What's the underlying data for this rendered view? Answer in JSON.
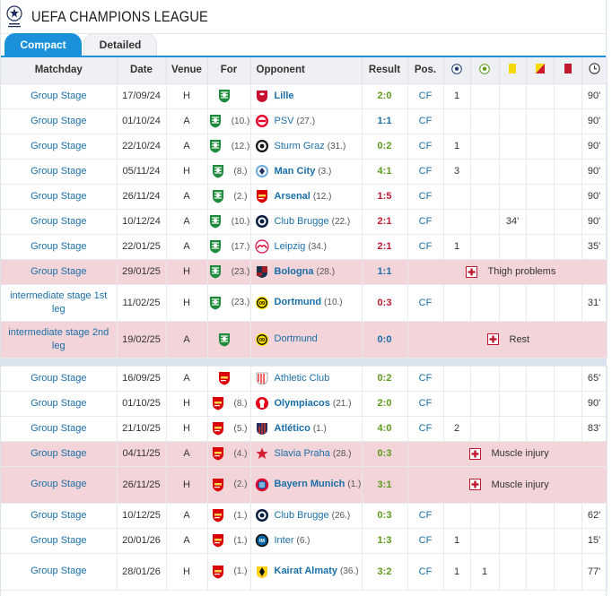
{
  "header": {
    "title": "UEFA CHAMPIONS LEAGUE"
  },
  "tabs": [
    {
      "label": "Compact",
      "active": true
    },
    {
      "label": "Detailed",
      "active": false
    }
  ],
  "columns": {
    "matchday": "Matchday",
    "date": "Date",
    "venue": "Venue",
    "for": "For",
    "opponent": "Opponent",
    "result": "Result",
    "pos": "Pos."
  },
  "colors": {
    "accent": "#1a91da",
    "win": "#5b9a1b",
    "draw": "#1a6fa8",
    "loss": "#c0182d",
    "injury_row": "#f2d4d9"
  },
  "rows": [
    {
      "matchday": "Group Stage",
      "date": "17/09/24",
      "venue": "H",
      "for_club": "sporting",
      "for_rank": "",
      "opponent": "Lille",
      "opp_crest": "lille",
      "opp_rank": "",
      "opp_bold": true,
      "result": "2:0",
      "res": "w",
      "pos": "CF",
      "goals": "1",
      "assists": "",
      "yellow": "",
      "second_yellow": "",
      "red": "",
      "minutes": "90'"
    },
    {
      "matchday": "Group Stage",
      "date": "01/10/24",
      "venue": "A",
      "for_club": "sporting",
      "for_rank": "(10.)",
      "opponent": "PSV",
      "opp_crest": "psv",
      "opp_rank": "(27.)",
      "opp_bold": false,
      "result": "1:1",
      "res": "d",
      "pos": "CF",
      "goals": "",
      "assists": "",
      "yellow": "",
      "second_yellow": "",
      "red": "",
      "minutes": "90'"
    },
    {
      "matchday": "Group Stage",
      "date": "22/10/24",
      "venue": "A",
      "for_club": "sporting",
      "for_rank": "(12.)",
      "opponent": "Sturm Graz",
      "opp_crest": "sturm",
      "opp_rank": "(31.)",
      "opp_bold": false,
      "result": "0:2",
      "res": "w",
      "pos": "CF",
      "goals": "1",
      "assists": "",
      "yellow": "",
      "second_yellow": "",
      "red": "",
      "minutes": "90'"
    },
    {
      "matchday": "Group Stage",
      "date": "05/11/24",
      "venue": "H",
      "for_club": "sporting",
      "for_rank": "(8.)",
      "opponent": "Man City",
      "opp_crest": "mancity",
      "opp_rank": "(3.)",
      "opp_bold": true,
      "result": "4:1",
      "res": "w",
      "pos": "CF",
      "goals": "3",
      "assists": "",
      "yellow": "",
      "second_yellow": "",
      "red": "",
      "minutes": "90'"
    },
    {
      "matchday": "Group Stage",
      "date": "26/11/24",
      "venue": "A",
      "for_club": "sporting",
      "for_rank": "(2.)",
      "opponent": "Arsenal",
      "opp_crest": "arsenal",
      "opp_rank": "(12.)",
      "opp_bold": true,
      "result": "1:5",
      "res": "l",
      "pos": "CF",
      "goals": "",
      "assists": "",
      "yellow": "",
      "second_yellow": "",
      "red": "",
      "minutes": "90'"
    },
    {
      "matchday": "Group Stage",
      "date": "10/12/24",
      "venue": "A",
      "for_club": "sporting",
      "for_rank": "(10.)",
      "opponent": "Club Brugge",
      "opp_crest": "brugge",
      "opp_rank": "(22.)",
      "opp_bold": false,
      "result": "2:1",
      "res": "l",
      "pos": "CF",
      "goals": "",
      "assists": "",
      "yellow": "34'",
      "second_yellow": "",
      "red": "",
      "minutes": "90'"
    },
    {
      "matchday": "Group Stage",
      "date": "22/01/25",
      "venue": "A",
      "for_club": "sporting",
      "for_rank": "(17.)",
      "opponent": "Leipzig",
      "opp_crest": "leipzig",
      "opp_rank": "(34.)",
      "opp_bold": false,
      "result": "2:1",
      "res": "l",
      "pos": "CF",
      "goals": "1",
      "assists": "",
      "yellow": "",
      "second_yellow": "",
      "red": "",
      "minutes": "35'"
    },
    {
      "matchday": "Group Stage",
      "date": "29/01/25",
      "venue": "H",
      "for_club": "sporting",
      "for_rank": "(23.)",
      "opponent": "Bologna",
      "opp_crest": "bologna",
      "opp_rank": "(28.)",
      "opp_bold": true,
      "result": "1:1",
      "res": "d",
      "injury": "Thigh problems"
    },
    {
      "matchday": "intermediate stage 1st leg",
      "date": "11/02/25",
      "venue": "H",
      "for_club": "sporting",
      "for_rank": "(23.)",
      "opponent": "Dortmund",
      "opp_crest": "dortmund",
      "opp_rank": "(10.)",
      "opp_bold": true,
      "result": "0:3",
      "res": "l",
      "pos": "CF",
      "goals": "",
      "assists": "",
      "yellow": "",
      "second_yellow": "",
      "red": "",
      "minutes": "31'",
      "tall": true
    },
    {
      "matchday": "intermediate stage 2nd leg",
      "date": "19/02/25",
      "venue": "A",
      "for_club": "sporting",
      "for_rank": "",
      "opponent": "Dortmund",
      "opp_crest": "dortmund",
      "opp_rank": "",
      "opp_bold": false,
      "result": "0:0",
      "res": "d",
      "injury": "Rest",
      "tall": true
    },
    {
      "separator": true
    },
    {
      "matchday": "Group Stage",
      "date": "16/09/25",
      "venue": "A",
      "for_club": "arsenal",
      "for_rank": "",
      "opponent": "Athletic Club",
      "opp_crest": "athletic",
      "opp_rank": "",
      "opp_bold": false,
      "result": "0:2",
      "res": "w",
      "pos": "CF",
      "goals": "",
      "assists": "",
      "yellow": "",
      "second_yellow": "",
      "red": "",
      "minutes": "65'"
    },
    {
      "matchday": "Group Stage",
      "date": "01/10/25",
      "venue": "H",
      "for_club": "arsenal",
      "for_rank": "(8.)",
      "opponent": "Olympiacos",
      "opp_crest": "olympiacos",
      "opp_rank": "(21.)",
      "opp_bold": true,
      "result": "2:0",
      "res": "w",
      "pos": "CF",
      "goals": "",
      "assists": "",
      "yellow": "",
      "second_yellow": "",
      "red": "",
      "minutes": "90'"
    },
    {
      "matchday": "Group Stage",
      "date": "21/10/25",
      "venue": "H",
      "for_club": "arsenal",
      "for_rank": "(5.)",
      "opponent": "Atlético",
      "opp_crest": "atletico",
      "opp_rank": "(1.)",
      "opp_bold": true,
      "result": "4:0",
      "res": "w",
      "pos": "CF",
      "goals": "2",
      "assists": "",
      "yellow": "",
      "second_yellow": "",
      "red": "",
      "minutes": "83'"
    },
    {
      "matchday": "Group Stage",
      "date": "04/11/25",
      "venue": "A",
      "for_club": "arsenal",
      "for_rank": "(4.)",
      "opponent": "Slavia Praha",
      "opp_crest": "slavia",
      "opp_rank": "(28.)",
      "opp_bold": false,
      "result": "0:3",
      "res": "w",
      "injury": "Muscle injury"
    },
    {
      "matchday": "Group Stage",
      "date": "26/11/25",
      "venue": "H",
      "for_club": "arsenal",
      "for_rank": "(2.)",
      "opponent": "Bayern Munich",
      "opp_crest": "bayern",
      "opp_rank": "(1.)",
      "opp_bold": true,
      "result": "3:1",
      "res": "w",
      "injury": "Muscle injury",
      "tall": true
    },
    {
      "matchday": "Group Stage",
      "date": "10/12/25",
      "venue": "A",
      "for_club": "arsenal",
      "for_rank": "(1.)",
      "opponent": "Club Brugge",
      "opp_crest": "brugge",
      "opp_rank": "(26.)",
      "opp_bold": false,
      "result": "0:3",
      "res": "w",
      "pos": "CF",
      "goals": "",
      "assists": "",
      "yellow": "",
      "second_yellow": "",
      "red": "",
      "minutes": "62'"
    },
    {
      "matchday": "Group Stage",
      "date": "20/01/26",
      "venue": "A",
      "for_club": "arsenal",
      "for_rank": "(1.)",
      "opponent": "Inter",
      "opp_crest": "inter",
      "opp_rank": "(6.)",
      "opp_bold": false,
      "result": "1:3",
      "res": "w",
      "pos": "CF",
      "goals": "1",
      "assists": "",
      "yellow": "",
      "second_yellow": "",
      "red": "",
      "minutes": "15'"
    },
    {
      "matchday": "Group Stage",
      "date": "28/01/26",
      "venue": "H",
      "for_club": "arsenal",
      "for_rank": "(1.)",
      "opponent": "Kairat Almaty",
      "opp_crest": "kairat",
      "opp_rank": "(36.)",
      "opp_bold": true,
      "result": "3:2",
      "res": "w",
      "pos": "CF",
      "goals": "1",
      "assists": "1",
      "yellow": "",
      "second_yellow": "",
      "red": "",
      "minutes": "77'",
      "tall": true
    }
  ]
}
